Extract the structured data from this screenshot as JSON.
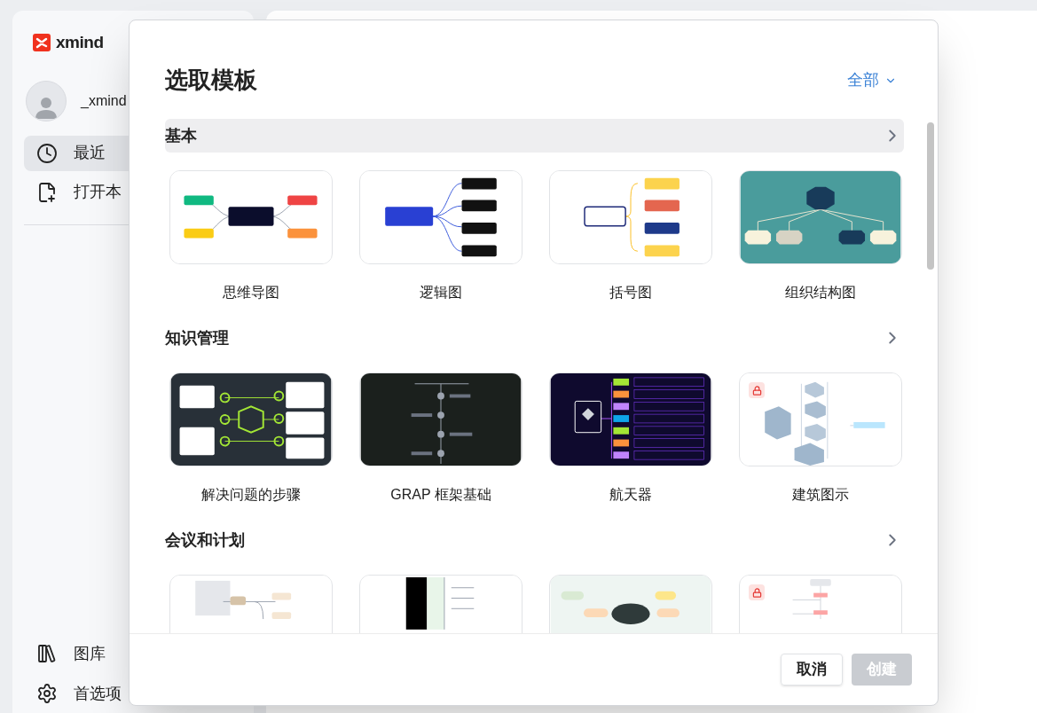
{
  "sidebar": {
    "logo": "xmind",
    "user": "_xmind",
    "items": [
      {
        "label": "最近",
        "selected": true
      },
      {
        "label": "打开本",
        "selected": false
      }
    ],
    "bottom_items": [
      {
        "label": "图库"
      },
      {
        "label": "首选项"
      }
    ]
  },
  "dialog": {
    "title": "选取模板",
    "filter": "全部",
    "sections": [
      {
        "title": "基本",
        "highlighted": true,
        "templates": [
          {
            "name": "思维导图",
            "kind": "mindmap",
            "locked": false
          },
          {
            "name": "逻辑图",
            "kind": "logic",
            "locked": false
          },
          {
            "name": "括号图",
            "kind": "brace",
            "locked": false
          },
          {
            "name": "组织结构图",
            "kind": "org",
            "locked": false
          }
        ]
      },
      {
        "title": "知识管理",
        "highlighted": false,
        "templates": [
          {
            "name": "解决问题的步骤",
            "kind": "steps",
            "locked": false
          },
          {
            "name": "GRAP 框架基础",
            "kind": "timeline",
            "locked": false
          },
          {
            "name": "航天器",
            "kind": "space",
            "locked": false
          },
          {
            "name": "建筑图示",
            "kind": "building",
            "locked": true
          }
        ]
      },
      {
        "title": "会议和计划",
        "highlighted": false,
        "templates": [
          {
            "kind": "flow",
            "locked": false
          },
          {
            "kind": "table",
            "locked": false
          },
          {
            "kind": "mint",
            "locked": false
          },
          {
            "kind": "plan",
            "locked": true
          }
        ]
      }
    ],
    "buttons": [
      {
        "label": "取消",
        "kind": "secondary",
        "disabled": false
      },
      {
        "label": "创建",
        "kind": "primary",
        "disabled": true
      }
    ]
  }
}
